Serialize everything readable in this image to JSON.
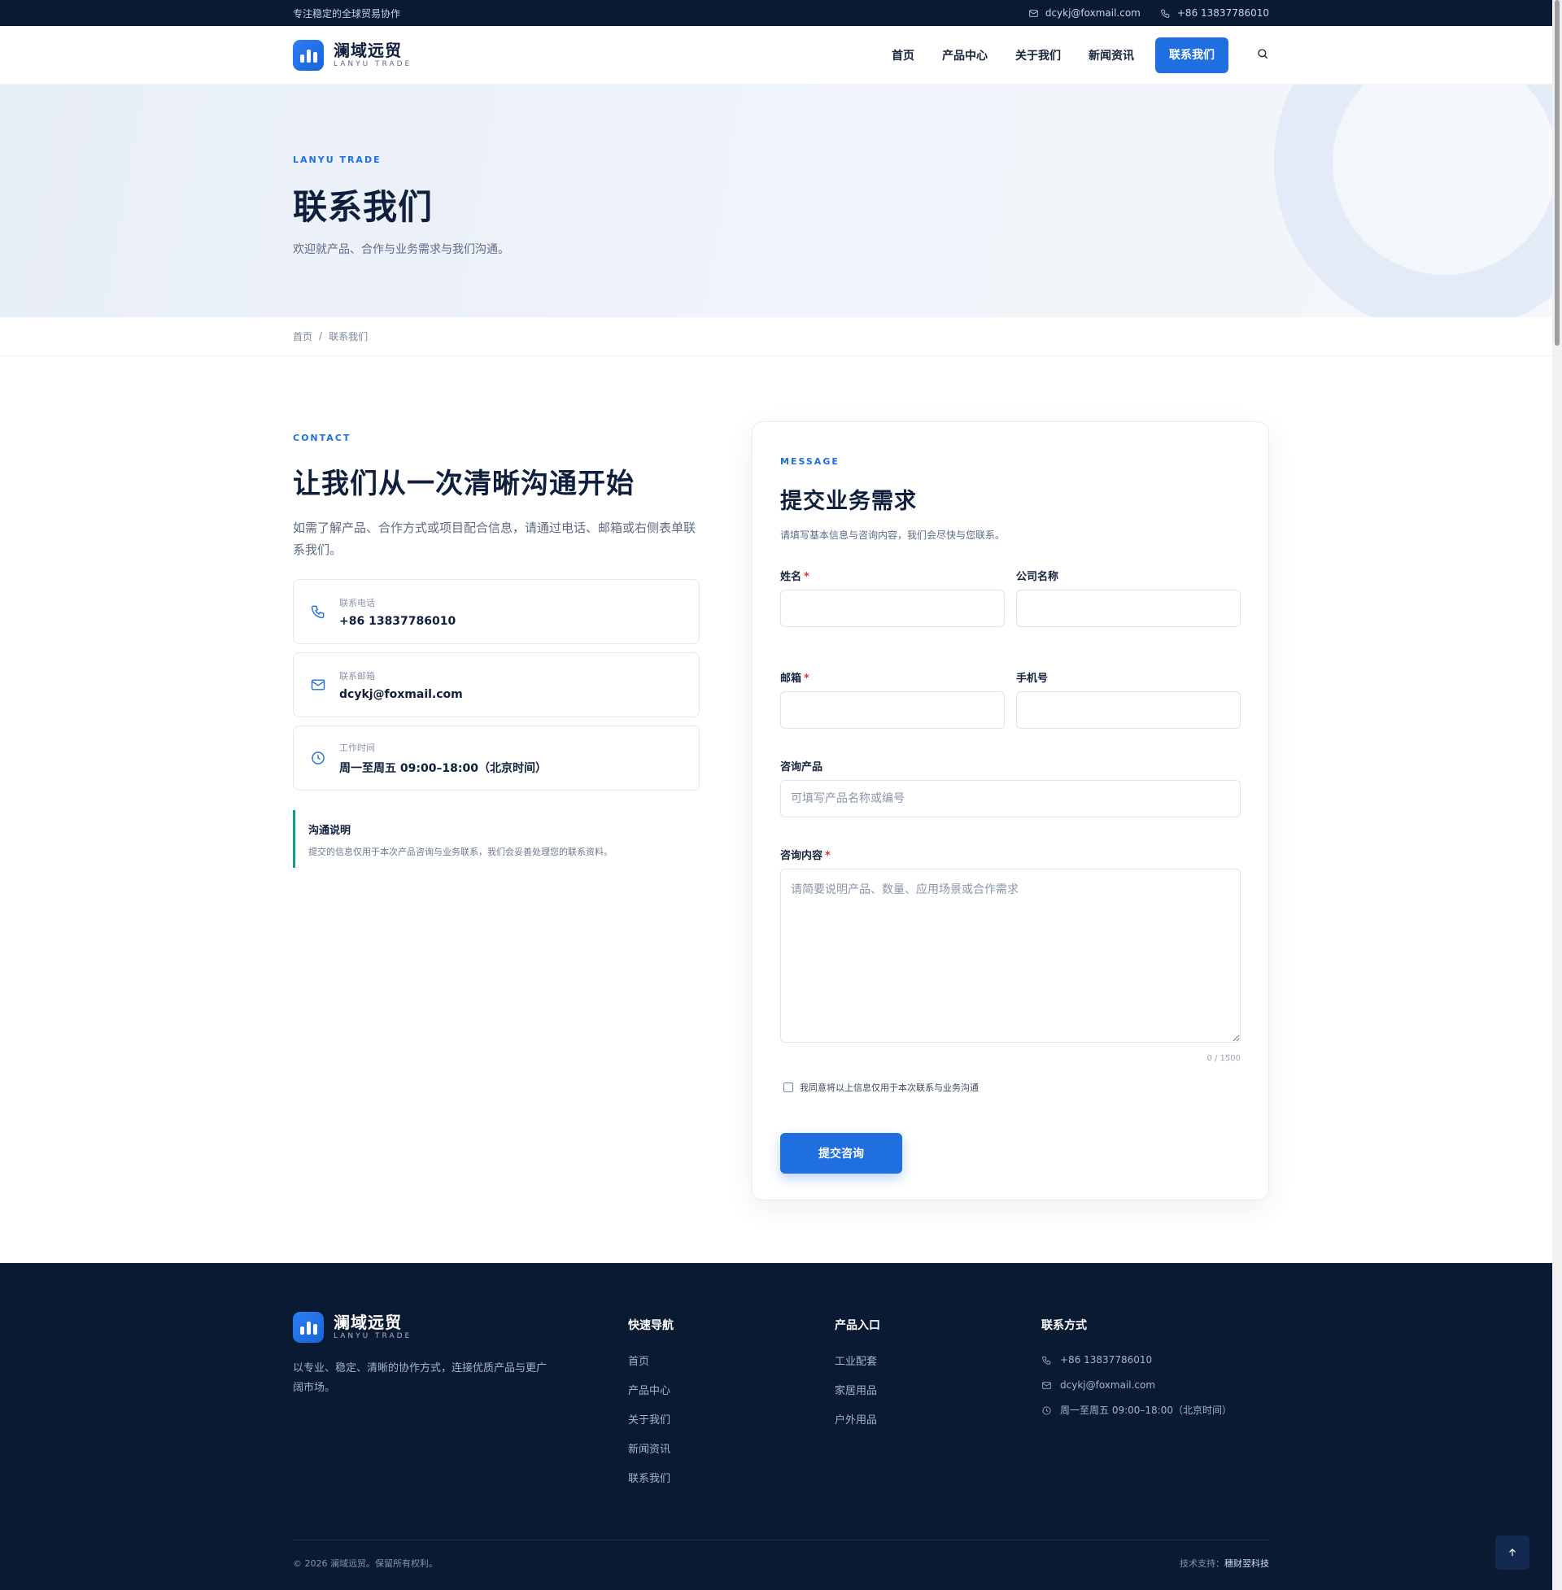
{
  "topbar": {
    "tagline": "专注稳定的全球贸易协作",
    "email": "dcykj@foxmail.com",
    "phone": "+86 13837786010"
  },
  "header": {
    "logo_cn": "澜域远贸",
    "logo_en": "LANYU TRADE",
    "nav": [
      "首页",
      "产品中心",
      "关于我们",
      "新闻资讯"
    ],
    "cta": "联系我们"
  },
  "hero": {
    "eyebrow": "LANYU TRADE",
    "title": "联系我们",
    "subtitle": "欢迎就产品、合作与业务需求与我们沟通。"
  },
  "breadcrumb": {
    "home": "首页",
    "sep": "/",
    "current": "联系我们"
  },
  "contact": {
    "eyebrow": "CONTACT",
    "title": "让我们从一次清晰沟通开始",
    "lead": "如需了解产品、合作方式或项目配合信息，请通过电话、邮箱或右侧表单联系我们。",
    "cards": [
      {
        "label": "联系电话",
        "value": "+86 13837786010",
        "icon": "phone-icon"
      },
      {
        "label": "联系邮箱",
        "value": "dcykj@foxmail.com",
        "icon": "mail-icon"
      },
      {
        "label": "工作时间",
        "value": "周一至周五 09:00–18:00（北京时间）",
        "icon": "clock-icon"
      }
    ],
    "note_title": "沟通说明",
    "note_desc": "提交的信息仅用于本次产品咨询与业务联系，我们会妥善处理您的联系资料。"
  },
  "form": {
    "eyebrow": "MESSAGE",
    "title": "提交业务需求",
    "subtitle": "请填写基本信息与咨询内容，我们会尽快与您联系。",
    "name_label": "姓名",
    "company_label": "公司名称",
    "email_label": "邮箱",
    "mobile_label": "手机号",
    "product_label": "咨询产品",
    "product_placeholder": "可填写产品名称或编号",
    "content_label": "咨询内容",
    "content_placeholder": "请简要说明产品、数量、应用场景或合作需求",
    "required_mark": "*",
    "counter": "0 / 1500",
    "agree": "我同意将以上信息仅用于本次联系与业务沟通",
    "submit": "提交咨询"
  },
  "footer": {
    "logo_cn": "澜域远贸",
    "logo_en": "LANYU TRADE",
    "desc": "以专业、稳定、清晰的协作方式，连接优质产品与更广阔市场。",
    "nav_title": "快速导航",
    "nav_items": [
      "首页",
      "产品中心",
      "关于我们",
      "新闻资讯",
      "联系我们"
    ],
    "product_title": "产品入口",
    "product_items": [
      "工业配套",
      "家居用品",
      "户外用品"
    ],
    "contact_title": "联系方式",
    "contact_phone": "+86 13837786010",
    "contact_email": "dcykj@foxmail.com",
    "contact_hours": "周一至周五 09:00–18:00（北京时间）",
    "copyright": "© 2026 澜域远贸。保留所有权利。",
    "support_label": "技术支持：",
    "support_name": "穗财翌科技"
  },
  "colors": {
    "brand": "#1f6fe0",
    "dark": "#0b1a33",
    "accent_teal": "#1a9a8a",
    "required": "#e03131"
  }
}
